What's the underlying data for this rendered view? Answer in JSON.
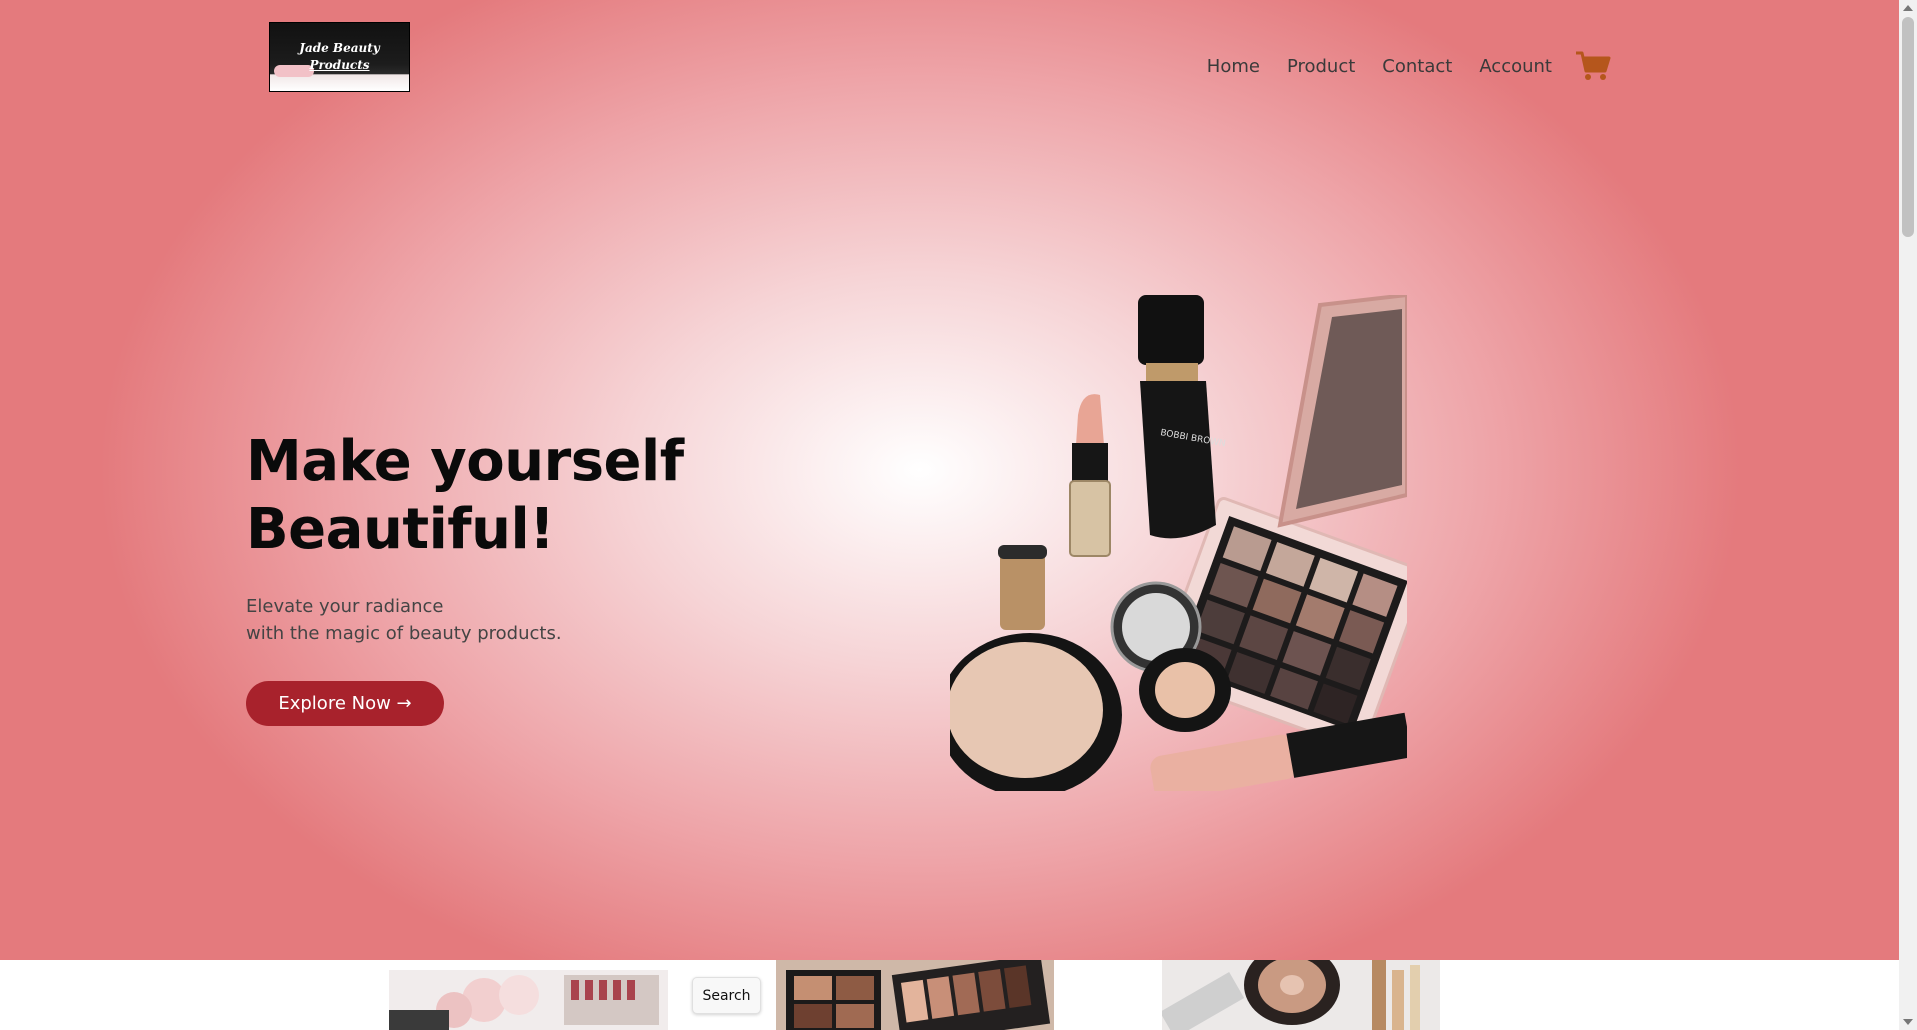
{
  "brand": {
    "logo_line1": "Jade Beauty",
    "logo_line2": "Products"
  },
  "nav": {
    "items": [
      {
        "label": "Home"
      },
      {
        "label": "Product"
      },
      {
        "label": "Contact"
      },
      {
        "label": "Account"
      }
    ],
    "cart_icon": "shopping-cart-icon",
    "cart_color": "#b5561c"
  },
  "hero": {
    "headline_line1": "Make yourself",
    "headline_line2": "Beautiful!",
    "subtitle_line1": "Elevate your radiance",
    "subtitle_line2": "with the magic of beauty products.",
    "cta_label": "Explore Now →",
    "cta_color": "#a8222c"
  },
  "search": {
    "label": "Search"
  },
  "colors": {
    "hero_edge": "#e47a7d",
    "hero_center": "#ffffff"
  }
}
